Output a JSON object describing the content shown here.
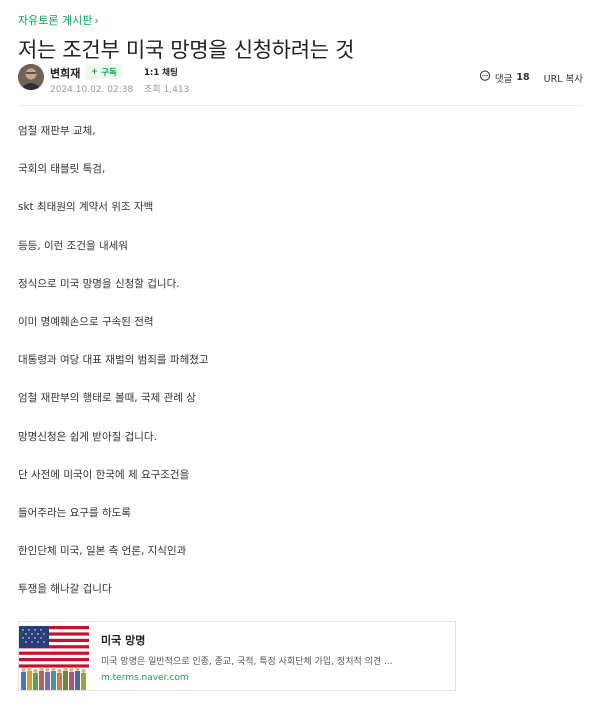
{
  "breadcrumb": {
    "board_name": "자유토론 게시판",
    "chevron": "›"
  },
  "post": {
    "title": "저는 조건부 미국 망명을 신청하려는 것",
    "author": "변희재",
    "subscribe_label": "구독",
    "chat_label": "1:1 채팅",
    "date": "2024.10.02. 02:38",
    "views_label": "조회",
    "views": "1,413",
    "comments_label": "댓글",
    "comments_count": "18",
    "url_copy_label": "URL 복사",
    "body": [
      "엄철 재판부 교체,",
      "국회의 태블릿 특검,",
      "skt 최태원의 계약서 위조 자백",
      "등등, 이런 조건을 내세워",
      "정식으로 미국 망명을 신청할 겁니다.",
      "이미 명예훼손으로 구속된 전력",
      "대통령과 여당 대표 재벌의 범죄를 파헤쳤고",
      "엄철 재판부의 행태로 볼때, 국제 관례 상",
      "망명신청은 쉽게 받아질 겁니다.",
      "단 사전에 미국이 한국에 제 요구조건을",
      "들어주라는 요구를 하도록",
      "한인단체 미국, 일본 측 언론, 지식인과",
      "투쟁을 해나갈 겁니다"
    ]
  },
  "link_card": {
    "title": "미국 망명",
    "description": "미국 망명은 일반적으로 인종, 종교, 국적, 특정 사회단체 가입, 정치적 의견 ...",
    "domain": "m.terms.naver.com"
  },
  "colors": {
    "accent": "#03a94d",
    "meta": "#999999",
    "text": "#333333"
  },
  "icons": {
    "subscribe": "plus-icon",
    "comment": "speech-bubble-icon",
    "thumbnail": "us-flag-image"
  }
}
